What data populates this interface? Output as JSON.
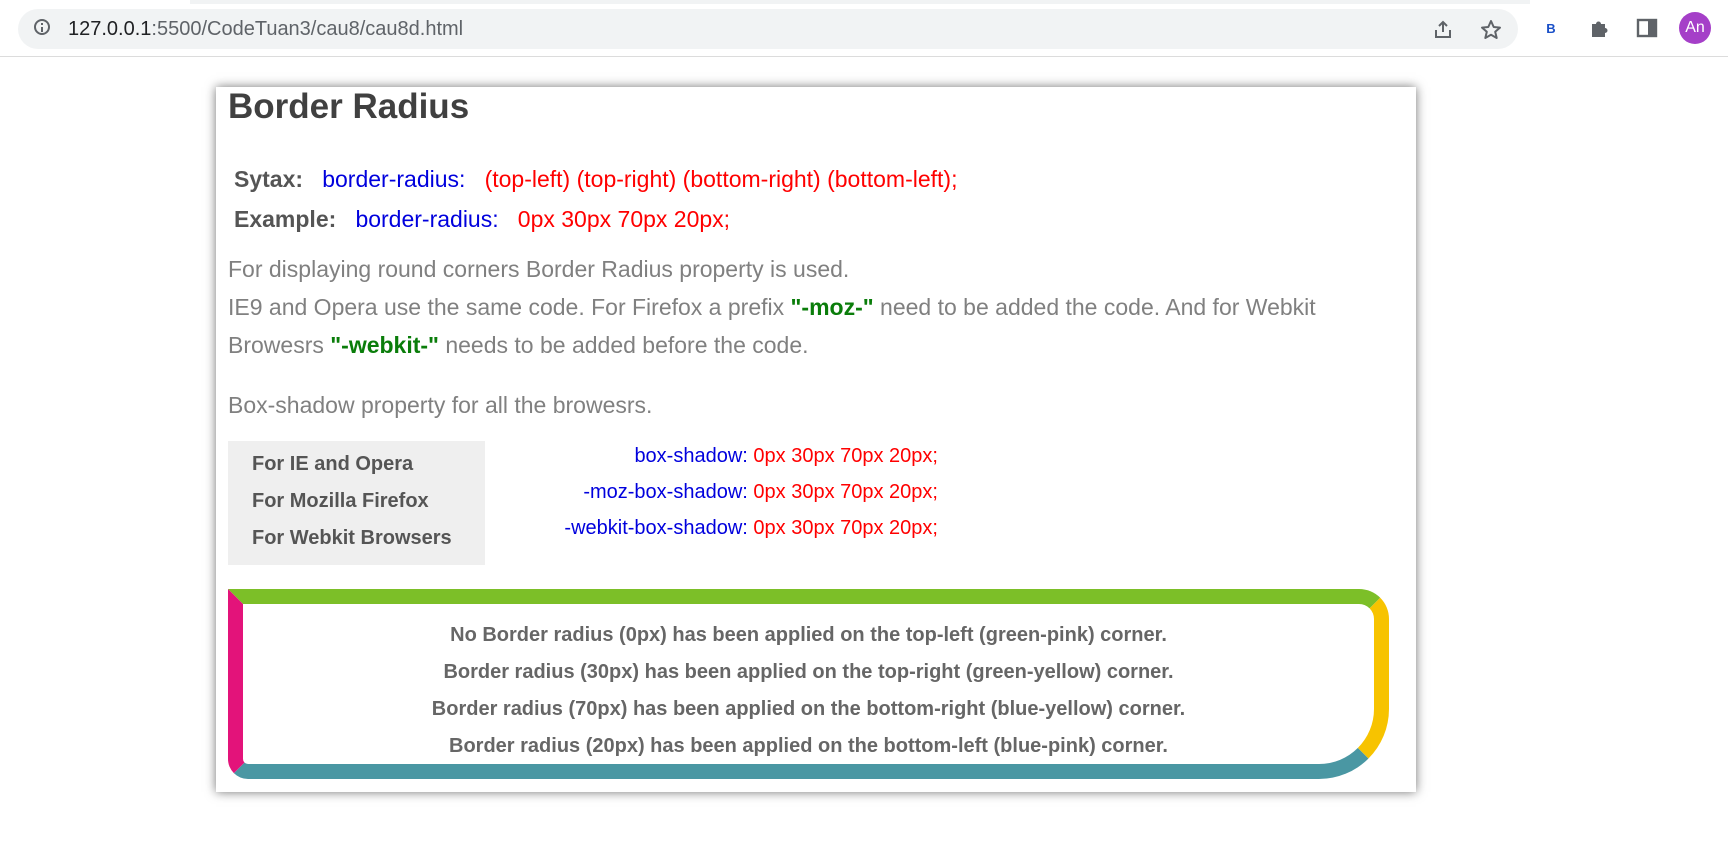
{
  "browser": {
    "url_host": "127.0.0.1",
    "url_path": ":5500/CodeTuan3/cau8/cau8d.html",
    "extension_label": "B",
    "profile_initials": "An"
  },
  "page": {
    "title": "Border Radius",
    "syntax": {
      "label": "Sytax:",
      "property": "border-radius:",
      "value": "(top-left) (top-right) (bottom-right) (bottom-left);"
    },
    "example": {
      "label": "Example:",
      "property": "border-radius:",
      "value": "0px 30px 70px 20px;"
    },
    "description": {
      "line1": "For displaying round corners Border Radius property is used.",
      "line2_prefix": "IE9 and Opera use the same code. For Firefox a prefix ",
      "moz_prefix": "\"-moz-\"",
      "line2_middle": " need to be added the code. And for Webkit Browesrs ",
      "webkit_prefix": "\"-webkit-\"",
      "line2_suffix": " needs to be added before the code."
    },
    "box_shadow_intro": "Box-shadow property for all the browesrs.",
    "browsers": [
      {
        "name": "For IE and Opera",
        "property": "box-shadow:",
        "value": "0px 30px 70px 20px;"
      },
      {
        "name": "For Mozilla Firefox",
        "property": "-moz-box-shadow:",
        "value": "0px 30px 70px 20px;"
      },
      {
        "name": "For Webkit Browsers",
        "property": "-webkit-box-shadow:",
        "value": "0px 30px 70px 20px;"
      }
    ],
    "demo_lines": [
      "No Border radius (0px) has been applied on the top-left (green-pink) corner.",
      "Border radius (30px) has been applied on the top-right (green-yellow) corner.",
      "Border radius (70px) has been applied on the bottom-right (blue-yellow) corner.",
      "Border radius (20px) has been applied on the bottom-left (blue-pink) corner."
    ]
  },
  "colors": {
    "top_border": "#7cbf28",
    "right_border": "#f7c300",
    "bottom_border": "#4a97a3",
    "left_border": "#e3137a",
    "property_blue": "#0000dd",
    "value_red": "#ff0000",
    "keyword_green": "#0a7d0a"
  }
}
